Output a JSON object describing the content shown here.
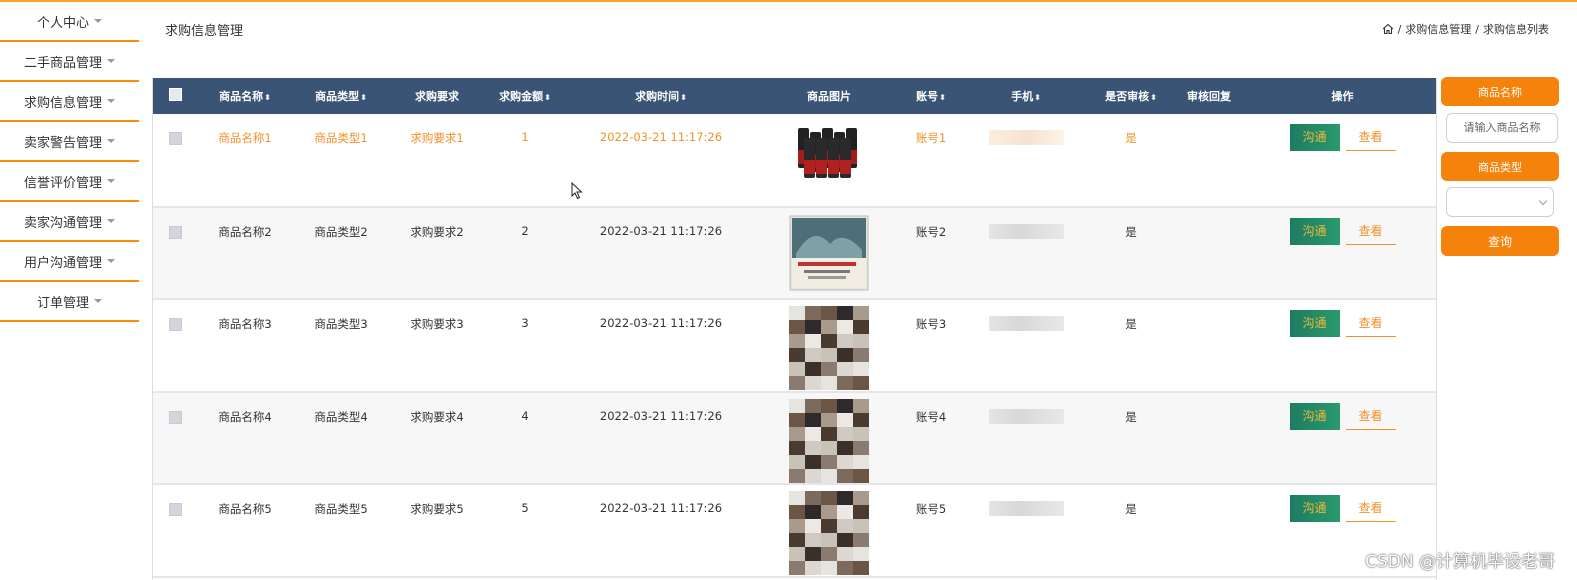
{
  "sidebar": {
    "items": [
      {
        "label": "个人中心"
      },
      {
        "label": "二手商品管理"
      },
      {
        "label": "求购信息管理"
      },
      {
        "label": "卖家警告管理"
      },
      {
        "label": "信誉评价管理"
      },
      {
        "label": "卖家沟通管理"
      },
      {
        "label": "用户沟通管理"
      },
      {
        "label": "订单管理"
      }
    ]
  },
  "header": {
    "title": "求购信息管理",
    "breadcrumb": [
      "求购信息管理",
      "求购信息列表"
    ],
    "breadcrumb_sep": "/"
  },
  "table": {
    "columns": [
      "商品名称",
      "商品类型",
      "求购要求",
      "求购金额",
      "求购时间",
      "商品图片",
      "账号",
      "手机",
      "是否审核",
      "审核回复",
      "操作"
    ],
    "sortable": [
      true,
      true,
      false,
      true,
      true,
      false,
      true,
      true,
      true,
      false,
      false
    ],
    "sort_icon": "⬍",
    "rows": [
      {
        "name": "商品名称1",
        "type": "商品类型1",
        "req": "求购要求1",
        "amount": "1",
        "time": "2022-03-21 11:17:26",
        "account": "账号1",
        "audited": "是",
        "reply": "",
        "chat": "沟通",
        "view": "查看",
        "image": "batteries"
      },
      {
        "name": "商品名称2",
        "type": "商品类型2",
        "req": "求购要求2",
        "amount": "2",
        "time": "2022-03-21 11:17:26",
        "account": "账号2",
        "audited": "是",
        "reply": "",
        "chat": "沟通",
        "view": "查看",
        "image": "book"
      },
      {
        "name": "商品名称3",
        "type": "商品类型3",
        "req": "求购要求3",
        "amount": "3",
        "time": "2022-03-21 11:17:26",
        "account": "账号3",
        "audited": "是",
        "reply": "",
        "chat": "沟通",
        "view": "查看",
        "image": "blurred"
      },
      {
        "name": "商品名称4",
        "type": "商品类型4",
        "req": "求购要求4",
        "amount": "4",
        "time": "2022-03-21 11:17:26",
        "account": "账号4",
        "audited": "是",
        "reply": "",
        "chat": "沟通",
        "view": "查看",
        "image": "blurred"
      },
      {
        "name": "商品名称5",
        "type": "商品类型5",
        "req": "求购要求5",
        "amount": "5",
        "time": "2022-03-21 11:17:26",
        "account": "账号5",
        "audited": "是",
        "reply": "",
        "chat": "沟通",
        "view": "查看",
        "image": "blurred"
      }
    ]
  },
  "search": {
    "name_label": "商品名称",
    "name_placeholder": "请输入商品名称",
    "type_label": "商品类型",
    "type_value": "",
    "query_label": "查询"
  },
  "watermark": "CSDN @计算机毕设老哥",
  "colors": {
    "accent": "#f5820b",
    "header": "#3a5476",
    "chat_button": "#1d7c62",
    "highlight_text": "#f0922a"
  }
}
